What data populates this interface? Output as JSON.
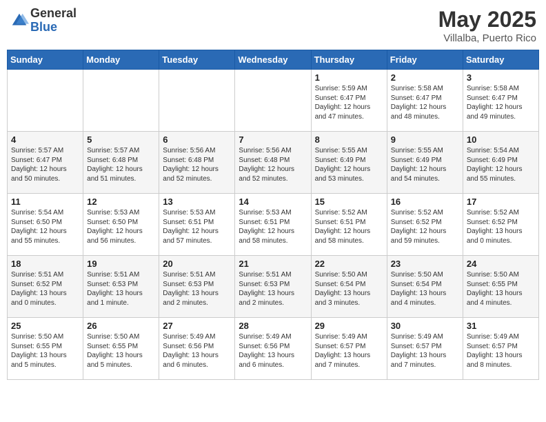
{
  "logo": {
    "general": "General",
    "blue": "Blue"
  },
  "title": {
    "month_year": "May 2025",
    "location": "Villalba, Puerto Rico"
  },
  "days_of_week": [
    "Sunday",
    "Monday",
    "Tuesday",
    "Wednesday",
    "Thursday",
    "Friday",
    "Saturday"
  ],
  "weeks": [
    [
      {
        "day": "",
        "text": ""
      },
      {
        "day": "",
        "text": ""
      },
      {
        "day": "",
        "text": ""
      },
      {
        "day": "",
        "text": ""
      },
      {
        "day": "1",
        "text": "Sunrise: 5:59 AM\nSunset: 6:47 PM\nDaylight: 12 hours\nand 47 minutes."
      },
      {
        "day": "2",
        "text": "Sunrise: 5:58 AM\nSunset: 6:47 PM\nDaylight: 12 hours\nand 48 minutes."
      },
      {
        "day": "3",
        "text": "Sunrise: 5:58 AM\nSunset: 6:47 PM\nDaylight: 12 hours\nand 49 minutes."
      }
    ],
    [
      {
        "day": "4",
        "text": "Sunrise: 5:57 AM\nSunset: 6:47 PM\nDaylight: 12 hours\nand 50 minutes."
      },
      {
        "day": "5",
        "text": "Sunrise: 5:57 AM\nSunset: 6:48 PM\nDaylight: 12 hours\nand 51 minutes."
      },
      {
        "day": "6",
        "text": "Sunrise: 5:56 AM\nSunset: 6:48 PM\nDaylight: 12 hours\nand 52 minutes."
      },
      {
        "day": "7",
        "text": "Sunrise: 5:56 AM\nSunset: 6:48 PM\nDaylight: 12 hours\nand 52 minutes."
      },
      {
        "day": "8",
        "text": "Sunrise: 5:55 AM\nSunset: 6:49 PM\nDaylight: 12 hours\nand 53 minutes."
      },
      {
        "day": "9",
        "text": "Sunrise: 5:55 AM\nSunset: 6:49 PM\nDaylight: 12 hours\nand 54 minutes."
      },
      {
        "day": "10",
        "text": "Sunrise: 5:54 AM\nSunset: 6:49 PM\nDaylight: 12 hours\nand 55 minutes."
      }
    ],
    [
      {
        "day": "11",
        "text": "Sunrise: 5:54 AM\nSunset: 6:50 PM\nDaylight: 12 hours\nand 55 minutes."
      },
      {
        "day": "12",
        "text": "Sunrise: 5:53 AM\nSunset: 6:50 PM\nDaylight: 12 hours\nand 56 minutes."
      },
      {
        "day": "13",
        "text": "Sunrise: 5:53 AM\nSunset: 6:51 PM\nDaylight: 12 hours\nand 57 minutes."
      },
      {
        "day": "14",
        "text": "Sunrise: 5:53 AM\nSunset: 6:51 PM\nDaylight: 12 hours\nand 58 minutes."
      },
      {
        "day": "15",
        "text": "Sunrise: 5:52 AM\nSunset: 6:51 PM\nDaylight: 12 hours\nand 58 minutes."
      },
      {
        "day": "16",
        "text": "Sunrise: 5:52 AM\nSunset: 6:52 PM\nDaylight: 12 hours\nand 59 minutes."
      },
      {
        "day": "17",
        "text": "Sunrise: 5:52 AM\nSunset: 6:52 PM\nDaylight: 13 hours\nand 0 minutes."
      }
    ],
    [
      {
        "day": "18",
        "text": "Sunrise: 5:51 AM\nSunset: 6:52 PM\nDaylight: 13 hours\nand 0 minutes."
      },
      {
        "day": "19",
        "text": "Sunrise: 5:51 AM\nSunset: 6:53 PM\nDaylight: 13 hours\nand 1 minute."
      },
      {
        "day": "20",
        "text": "Sunrise: 5:51 AM\nSunset: 6:53 PM\nDaylight: 13 hours\nand 2 minutes."
      },
      {
        "day": "21",
        "text": "Sunrise: 5:51 AM\nSunset: 6:53 PM\nDaylight: 13 hours\nand 2 minutes."
      },
      {
        "day": "22",
        "text": "Sunrise: 5:50 AM\nSunset: 6:54 PM\nDaylight: 13 hours\nand 3 minutes."
      },
      {
        "day": "23",
        "text": "Sunrise: 5:50 AM\nSunset: 6:54 PM\nDaylight: 13 hours\nand 4 minutes."
      },
      {
        "day": "24",
        "text": "Sunrise: 5:50 AM\nSunset: 6:55 PM\nDaylight: 13 hours\nand 4 minutes."
      }
    ],
    [
      {
        "day": "25",
        "text": "Sunrise: 5:50 AM\nSunset: 6:55 PM\nDaylight: 13 hours\nand 5 minutes."
      },
      {
        "day": "26",
        "text": "Sunrise: 5:50 AM\nSunset: 6:55 PM\nDaylight: 13 hours\nand 5 minutes."
      },
      {
        "day": "27",
        "text": "Sunrise: 5:49 AM\nSunset: 6:56 PM\nDaylight: 13 hours\nand 6 minutes."
      },
      {
        "day": "28",
        "text": "Sunrise: 5:49 AM\nSunset: 6:56 PM\nDaylight: 13 hours\nand 6 minutes."
      },
      {
        "day": "29",
        "text": "Sunrise: 5:49 AM\nSunset: 6:57 PM\nDaylight: 13 hours\nand 7 minutes."
      },
      {
        "day": "30",
        "text": "Sunrise: 5:49 AM\nSunset: 6:57 PM\nDaylight: 13 hours\nand 7 minutes."
      },
      {
        "day": "31",
        "text": "Sunrise: 5:49 AM\nSunset: 6:57 PM\nDaylight: 13 hours\nand 8 minutes."
      }
    ]
  ]
}
